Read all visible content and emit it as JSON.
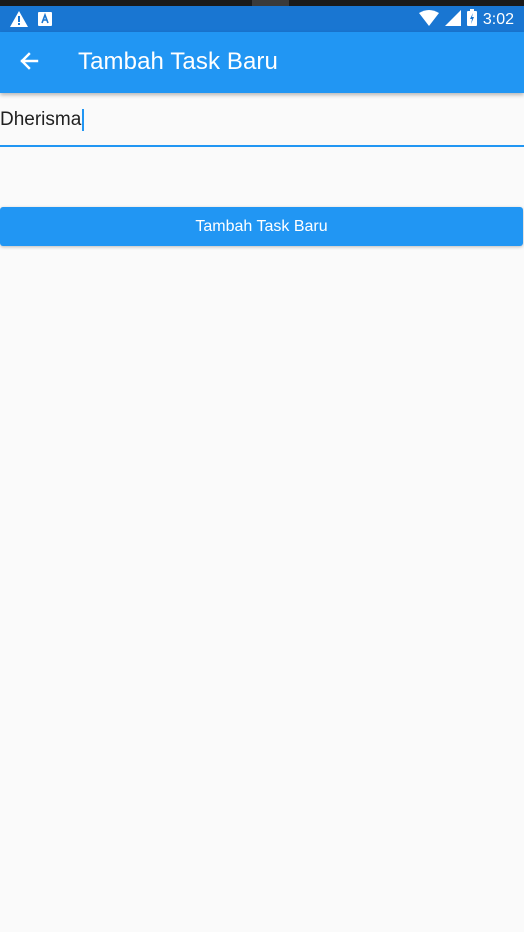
{
  "status_bar": {
    "time": "3:02",
    "icons": [
      "warning-icon",
      "a-badge-icon",
      "wifi-icon",
      "signal-icon",
      "battery-icon"
    ]
  },
  "app_bar": {
    "title": "Tambah Task Baru",
    "back_icon": "arrow-back-icon"
  },
  "task_input": {
    "value": "Dherisma"
  },
  "submit_button": {
    "label": "Tambah Task Baru"
  },
  "colors": {
    "primary": "#2196f3",
    "status_bar": "#1976d2",
    "background": "#fafafa"
  }
}
